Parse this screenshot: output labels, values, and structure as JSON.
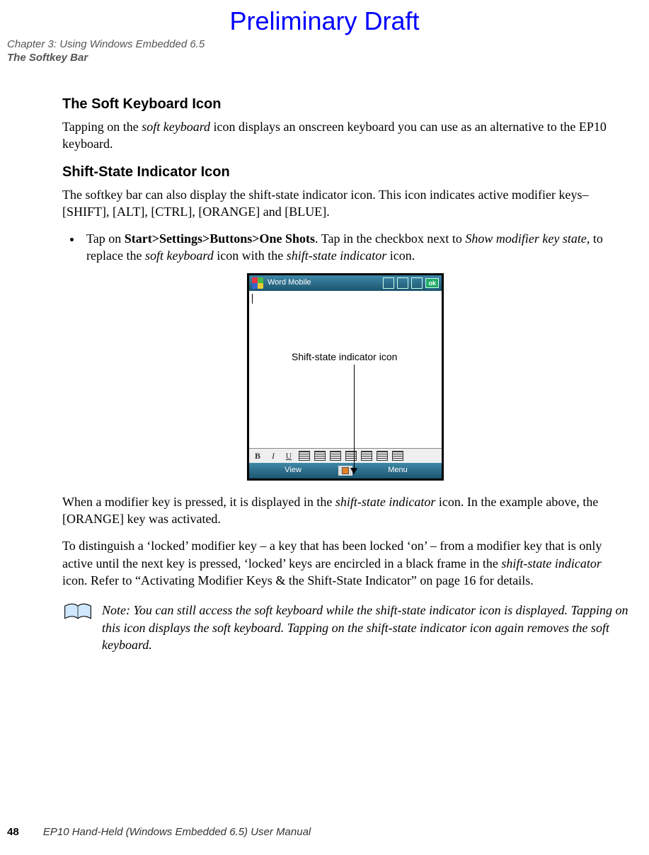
{
  "watermark": "Preliminary Draft",
  "running_head": {
    "line1": "Chapter 3: Using Windows Embedded 6.5",
    "line2": "The Softkey Bar"
  },
  "sections": {
    "h1": "The Soft Keyboard Icon",
    "p1a": "Tapping on the ",
    "p1b": "soft keyboard",
    "p1c": " icon displays an onscreen keyboard you can use as an alternative to the EP10 keyboard.",
    "h2": "Shift-State Indicator Icon",
    "p2": "The softkey bar can also display the shift-state indicator icon. This icon indicates active modifier keys–[SHIFT], [ALT], [CTRL], [ORANGE] and [BLUE].",
    "li_a": "Tap on ",
    "li_b": "Start>Settings>Buttons>One Shots",
    "li_c": ". Tap in the checkbox next to ",
    "li_d": "Show modifier key state,",
    "li_e": " to replace the ",
    "li_f": "soft keyboard",
    "li_g": " icon with the ",
    "li_h": "shift-state indicator",
    "li_i": " icon.",
    "p3a": "When a modifier key is pressed, it is displayed in the ",
    "p3b": "shift-state indicator",
    "p3c": " icon. In the example above, the [ORANGE] key was activated.",
    "p4a": "To distinguish a ‘locked’ modifier key – a key that has been locked ‘on’ – from a modifier key that is only active until the next key is pressed, ‘locked’ keys are encircled in a black frame in the ",
    "p4b": "shift-state indicator",
    "p4c": " icon. Refer to “Activating Modifier Keys & the Shift-State Indicator” on page 16 for details."
  },
  "figure": {
    "title": "Word Mobile",
    "ok": "ok",
    "callout": "Shift-state indicator icon",
    "view": "View",
    "menu": "Menu",
    "format_b": "B",
    "format_i": "I",
    "format_u": "U"
  },
  "note": {
    "label": "Note:",
    "text": " You can still access the soft keyboard while the shift-state indicator icon is displayed. Tapping on this icon displays the soft keyboard. Tapping on the shift-state indicator icon again removes the soft keyboard."
  },
  "footer": {
    "page": "48",
    "title": "EP10 Hand-Held (Windows Embedded 6.5) User Manual"
  }
}
